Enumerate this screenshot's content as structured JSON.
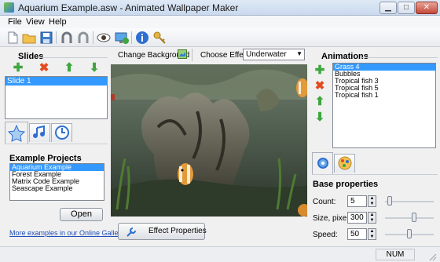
{
  "window": {
    "title": "Aquarium Example.asw - Animated Wallpaper Maker"
  },
  "menu": [
    "File",
    "View",
    "Help"
  ],
  "toolbar": {
    "buttons": [
      "new-file-icon",
      "open-folder-icon",
      "save-icon",
      "undo-magnet-icon",
      "redo-magnet-icon",
      "preview-eye-icon",
      "set-wallpaper-icon",
      "info-icon",
      "key-icon"
    ]
  },
  "slides": {
    "title": "Slides",
    "items": [
      "Slide 1"
    ],
    "selected": 0
  },
  "center": {
    "change_background_label": "Change Background",
    "choose_effect_label": "Choose Effect:",
    "effect_value": "Underwater",
    "effect_properties_label": "Effect Properties"
  },
  "example_projects": {
    "title": "Example Projects",
    "items": [
      "Aquarium Example",
      "Forest Example",
      "Matrix Code Example",
      "Seascape Example"
    ],
    "selected": 0,
    "open_label": "Open",
    "gallery_link": "More examples in our Online Gallery"
  },
  "animations": {
    "title": "Animations",
    "items": [
      "Grass 4",
      "Bubbles",
      "Tropical fish 3",
      "Tropical fish 5",
      "Tropical fish 1"
    ],
    "selected": 0
  },
  "base_properties": {
    "title": "Base properties",
    "count_label": "Count:",
    "count_value": "5",
    "size_label": "Size, pixels:",
    "size_value": "300",
    "speed_label": "Speed:",
    "speed_value": "50",
    "count_slider": 0.05,
    "size_slider": 0.6,
    "speed_slider": 0.5
  },
  "status": {
    "num": "NUM"
  },
  "colors": {
    "selection": "#3399ff",
    "add": "#3fa63f",
    "delete": "#e24a1f",
    "accent": "#2e7fd6"
  }
}
